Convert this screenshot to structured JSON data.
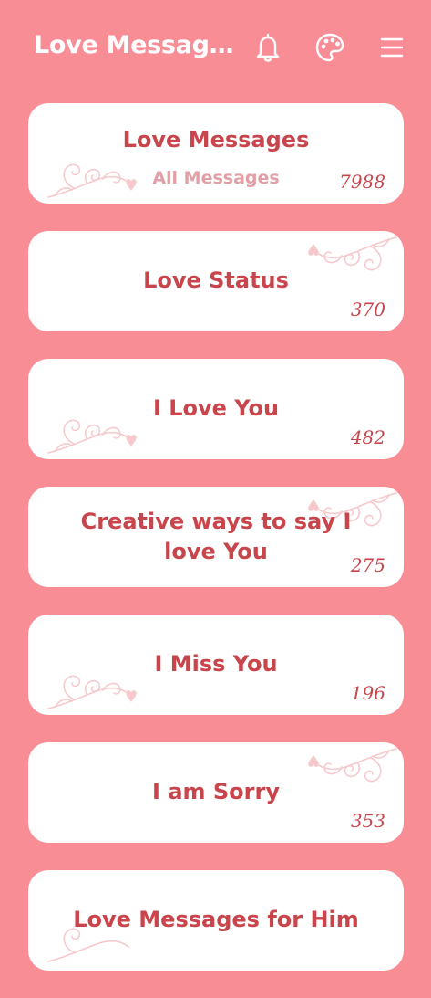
{
  "app_bar": {
    "title": "Love Messages",
    "icons": [
      "bell-icon",
      "palette-icon",
      "menu-icon"
    ]
  },
  "categories": [
    {
      "title": "Love Messages",
      "subtitle": "All Messages",
      "count": "7988"
    },
    {
      "title": "Love Status",
      "count": "370"
    },
    {
      "title": "I Love You",
      "count": "482"
    },
    {
      "title": "Creative ways to say I love You",
      "count": "275"
    },
    {
      "title": "I Miss You",
      "count": "196"
    },
    {
      "title": "I am Sorry",
      "count": "353"
    },
    {
      "title": "Love Messages for Him"
    }
  ],
  "colors": {
    "background": "#f88d95",
    "card": "#ffffff",
    "title_text": "#c9454c",
    "subtitle_text": "#e2a0a6",
    "ornament": "#f6c9cd"
  }
}
